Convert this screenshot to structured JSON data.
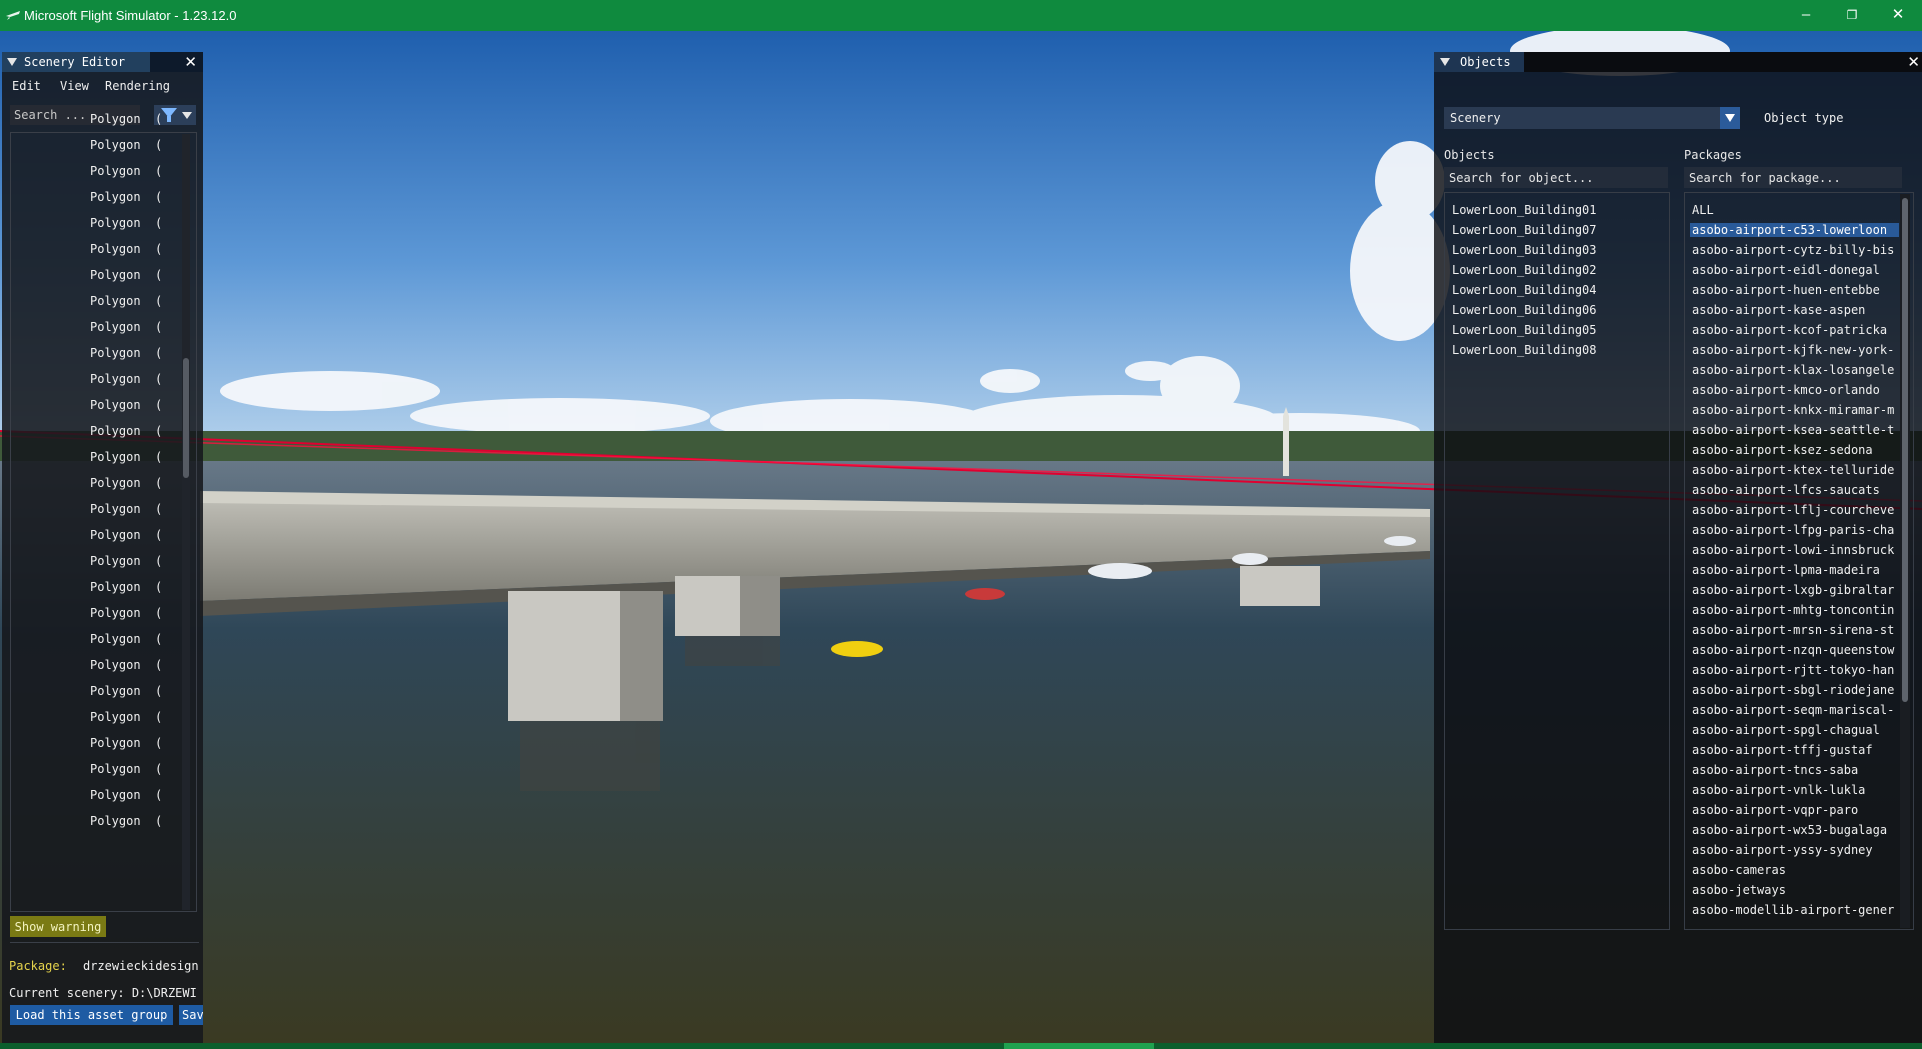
{
  "window": {
    "title": "Microsoft Flight Simulator - 1.23.12.0"
  },
  "scenery_editor": {
    "title": "Scenery Editor",
    "menu": [
      "Edit",
      "View",
      "Rendering"
    ],
    "search_placeholder": "Search ...",
    "list_items": [
      "Polygon  (",
      "Polygon  (",
      "Polygon  (",
      "Polygon  (",
      "Polygon  (",
      "Polygon  (",
      "Polygon  (",
      "Polygon  (",
      "Polygon  (",
      "Polygon  (",
      "Polygon  (",
      "Polygon  (",
      "Polygon  (",
      "Polygon  (",
      "Polygon  (",
      "Polygon  (",
      "Polygon  (",
      "Polygon  (",
      "Polygon  (",
      "Polygon  (",
      "Polygon  (",
      "Polygon  (",
      "Polygon  (",
      "Polygon  (",
      "Polygon  (",
      "Polygon  (",
      "Polygon  (",
      "Polygon  ("
    ],
    "show_warning_label": "Show warning",
    "package_label": "Package:",
    "package_value": "drzewieckidesign",
    "current_scenery": "Current scenery: D:\\DRZEWI",
    "load_button": "Load this asset group",
    "save_button": "Sav"
  },
  "objects_panel": {
    "title": "Objects",
    "type_dropdown_value": "Scenery",
    "type_label": "Object type",
    "objects_label": "Objects",
    "packages_label": "Packages",
    "object_search_placeholder": "Search for object...",
    "package_search_placeholder": "Search for package...",
    "objects": [
      "LowerLoon_Building01",
      "LowerLoon_Building07",
      "LowerLoon_Building03",
      "LowerLoon_Building02",
      "LowerLoon_Building04",
      "LowerLoon_Building06",
      "LowerLoon_Building05",
      "LowerLoon_Building08"
    ],
    "packages": [
      "ALL",
      "asobo-airport-c53-lowerloon",
      "asobo-airport-cytz-billy-bis",
      "asobo-airport-eidl-donegal",
      "asobo-airport-huen-entebbe",
      "asobo-airport-kase-aspen",
      "asobo-airport-kcof-patricka",
      "asobo-airport-kjfk-new-york-",
      "asobo-airport-klax-losangele",
      "asobo-airport-kmco-orlando",
      "asobo-airport-knkx-miramar-m",
      "asobo-airport-ksea-seattle-t",
      "asobo-airport-ksez-sedona",
      "asobo-airport-ktex-telluride",
      "asobo-airport-lfcs-saucats",
      "asobo-airport-lflj-courcheve",
      "asobo-airport-lfpg-paris-cha",
      "asobo-airport-lowi-innsbruck",
      "asobo-airport-lpma-madeira",
      "asobo-airport-lxgb-gibraltar",
      "asobo-airport-mhtg-toncontin",
      "asobo-airport-mrsn-sirena-st",
      "asobo-airport-nzqn-queenstow",
      "asobo-airport-rjtt-tokyo-han",
      "asobo-airport-sbgl-riodejane",
      "asobo-airport-seqm-mariscal-",
      "asobo-airport-spgl-chagual",
      "asobo-airport-tffj-gustaf",
      "asobo-airport-tncs-saba",
      "asobo-airport-vnlk-lukla",
      "asobo-airport-vqpr-paro",
      "asobo-airport-wx53-bugalaga",
      "asobo-airport-yssy-sydney",
      "asobo-cameras",
      "asobo-jetways",
      "asobo-modellib-airport-gener"
    ],
    "selected_package_index": 1
  },
  "colors": {
    "titlebar": "#0f8a3e",
    "accent": "#295a99",
    "warning": "#7a7a14"
  },
  "icons": {
    "app": "plane-icon",
    "panel_collapse": "triangle-down-icon",
    "filter": "filter-icon",
    "close": "close-icon"
  }
}
